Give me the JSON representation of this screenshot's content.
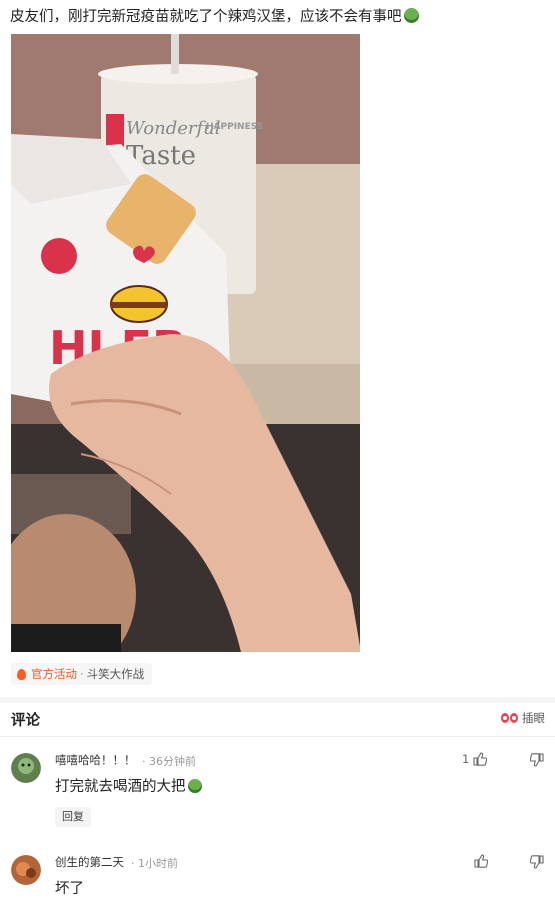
{
  "post": {
    "title": "皮友们，刚打完新冠疫苗就吃了个辣鸡汉堡，应该不会有事吧",
    "title_emoji": "vomiting-face-emoji",
    "photo_text": {
      "cup_line1": "Wonderful",
      "cup_line2": "Taste",
      "cup_line3": "HAPPINESS",
      "wrapper_text": "HI FR"
    }
  },
  "topic": {
    "icon": "flame-icon",
    "tag_official": "官方活动",
    "separator": "·",
    "tag_name": "斗笑大作战"
  },
  "comments_header": {
    "title": "评论",
    "sort_label": "插眼"
  },
  "comments": [
    {
      "username": "嘻嘻哈哈！！！",
      "time": "· 36分钟前",
      "text": "打完就去喝酒的大把",
      "like_count": "1",
      "reply_label": "回复"
    },
    {
      "username": "创生的第二天",
      "time": "· 1小时前",
      "text": "坏了",
      "like_count": ""
    }
  ],
  "colors": {
    "accent": "#f05a28",
    "muted": "#999999",
    "text": "#222222"
  }
}
